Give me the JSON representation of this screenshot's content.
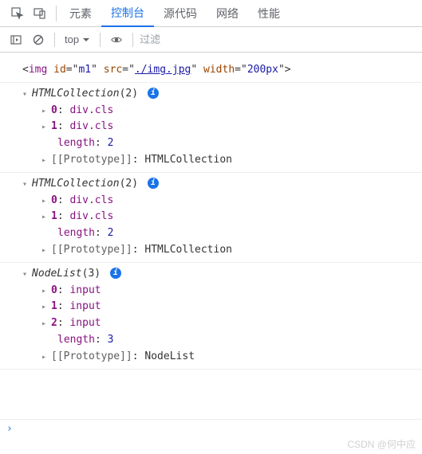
{
  "tabs": {
    "elements": "元素",
    "console": "控制台",
    "sources": "源代码",
    "network": "网络",
    "performance": "性能"
  },
  "toolbar": {
    "context": "top",
    "filter_placeholder": "过滤"
  },
  "img_line": {
    "tag": "img",
    "id_attr": "id",
    "id_val": "m1",
    "src_attr": "src",
    "src_val": "./img.jpg",
    "width_attr": "width",
    "width_val": "200px"
  },
  "sections": [
    {
      "type": "HTMLCollection",
      "count": "2",
      "items": [
        {
          "idx": "0",
          "val": "div.cls"
        },
        {
          "idx": "1",
          "val": "div.cls"
        }
      ],
      "length_label": "length",
      "length_val": "2",
      "proto_label": "[[Prototype]]",
      "proto_val": "HTMLCollection"
    },
    {
      "type": "HTMLCollection",
      "count": "2",
      "items": [
        {
          "idx": "0",
          "val": "div.cls"
        },
        {
          "idx": "1",
          "val": "div.cls"
        }
      ],
      "length_label": "length",
      "length_val": "2",
      "proto_label": "[[Prototype]]",
      "proto_val": "HTMLCollection"
    },
    {
      "type": "NodeList",
      "count": "3",
      "items": [
        {
          "idx": "0",
          "val": "input"
        },
        {
          "idx": "1",
          "val": "input"
        },
        {
          "idx": "2",
          "val": "input"
        }
      ],
      "length_label": "length",
      "length_val": "3",
      "proto_label": "[[Prototype]]",
      "proto_val": "NodeList"
    }
  ],
  "watermark": "CSDN @何中应",
  "info_badge": "i"
}
